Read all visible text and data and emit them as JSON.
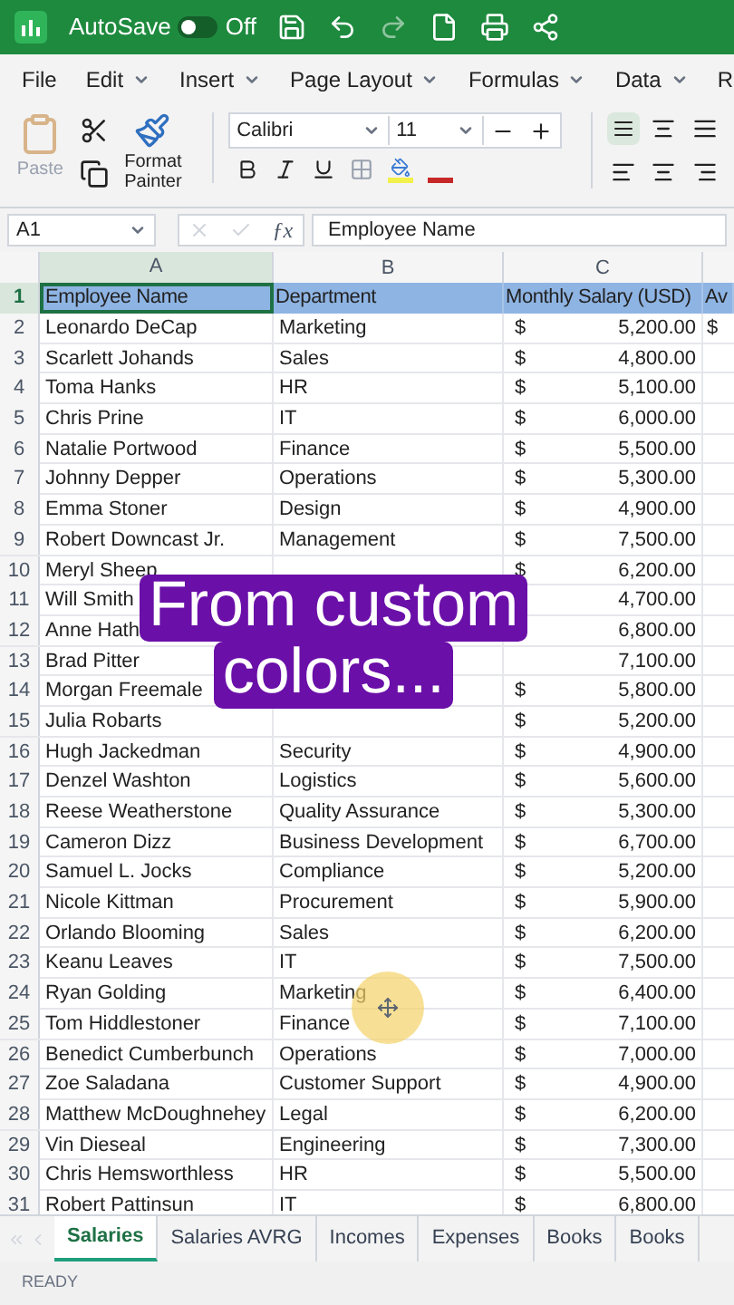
{
  "title_bar": {
    "autosave_label": "AutoSave",
    "autosave": {
      "on": false,
      "label": "Off"
    }
  },
  "menu": [
    {
      "label": "File",
      "caret": false
    },
    {
      "label": "Edit",
      "caret": true
    },
    {
      "label": "Insert",
      "caret": true
    },
    {
      "label": "Page Layout",
      "caret": true
    },
    {
      "label": "Formulas",
      "caret": true
    },
    {
      "label": "Data",
      "caret": true
    },
    {
      "label": "R",
      "caret": false
    }
  ],
  "ribbon": {
    "paste": {
      "label": "Paste",
      "disabled": true
    },
    "format_painter": "Format Painter",
    "font": "Calibri",
    "size": "11",
    "align_top_selected": true
  },
  "formula_bar": {
    "name_box": "A1",
    "function_label": "ƒx",
    "formula": "Employee Name"
  },
  "columns": [
    "A",
    "B",
    "C"
  ],
  "header_row": {
    "number": "1",
    "cells": [
      {
        "text": "Employee Name",
        "selected": true
      },
      {
        "text": "Department",
        "selected": false
      },
      {
        "text": "Monthly Salary (USD)",
        "selected": false
      },
      {
        "text": "Av",
        "selected": false
      }
    ]
  },
  "rows": [
    {
      "number": "2",
      "name": "Leonardo DeCap",
      "department": "Marketing",
      "currency": "$",
      "salary": "5,200.00",
      "column_d": "$"
    },
    {
      "number": "3",
      "name": "Scarlett Johands",
      "department": "Sales",
      "currency": "$",
      "salary": "4,800.00"
    },
    {
      "number": "4",
      "name": "Toma Hanks",
      "department": "HR",
      "currency": "$",
      "salary": "5,100.00"
    },
    {
      "number": "5",
      "name": "Chris Prine",
      "department": "IT",
      "currency": "$",
      "salary": "6,000.00"
    },
    {
      "number": "6",
      "name": "Natalie Portwood",
      "department": "Finance",
      "currency": "$",
      "salary": "5,500.00"
    },
    {
      "number": "7",
      "name": "Johnny Depper",
      "department": "Operations",
      "currency": "$",
      "salary": "5,300.00"
    },
    {
      "number": "8",
      "name": "Emma Stoner",
      "department": "Design",
      "currency": "$",
      "salary": "4,900.00"
    },
    {
      "number": "9",
      "name": "Robert Downcast Jr.",
      "department": "Management",
      "currency": "$",
      "salary": "7,500.00"
    },
    {
      "number": "10",
      "name": "Meryl Sheep",
      "currency": "$",
      "salary": "6,200.00"
    },
    {
      "number": "11",
      "name": "Will Smith",
      "salary": "4,700.00"
    },
    {
      "number": "12",
      "name": "Anne Hath",
      "salary": "6,800.00"
    },
    {
      "number": "13",
      "name": "Brad Pitter",
      "salary": "7,100.00"
    },
    {
      "number": "14",
      "name": "Morgan Freemale",
      "currency": "$",
      "salary": "5,800.00"
    },
    {
      "number": "15",
      "name": "Julia Robarts",
      "currency": "$",
      "salary": "5,200.00"
    },
    {
      "number": "16",
      "name": "Hugh Jackedman",
      "department": "Security",
      "currency": "$",
      "salary": "4,900.00"
    },
    {
      "number": "17",
      "name": "Denzel Washton",
      "department": "Logistics",
      "currency": "$",
      "salary": "5,600.00"
    },
    {
      "number": "18",
      "name": "Reese Weatherstone",
      "department": "Quality Assurance",
      "currency": "$",
      "salary": "5,300.00"
    },
    {
      "number": "19",
      "name": "Cameron Dizz",
      "department": "Business Development",
      "currency": "$",
      "salary": "6,700.00"
    },
    {
      "number": "20",
      "name": "Samuel L. Jocks",
      "department": "Compliance",
      "currency": "$",
      "salary": "5,200.00"
    },
    {
      "number": "21",
      "name": "Nicole Kittman",
      "department": "Procurement",
      "currency": "$",
      "salary": "5,900.00"
    },
    {
      "number": "22",
      "name": "Orlando Blooming",
      "department": "Sales",
      "currency": "$",
      "salary": "6,200.00"
    },
    {
      "number": "23",
      "name": "Keanu Leaves",
      "department": "IT",
      "currency": "$",
      "salary": "7,500.00"
    },
    {
      "number": "24",
      "name": "Ryan Golding",
      "department": "Marketing",
      "currency": "$",
      "salary": "6,400.00"
    },
    {
      "number": "25",
      "name": "Tom Hiddlestoner",
      "department": "Finance",
      "currency": "$",
      "salary": "7,100.00"
    },
    {
      "number": "26",
      "name": "Benedict Cumberbunch",
      "department": "Operations",
      "currency": "$",
      "salary": "7,000.00"
    },
    {
      "number": "27",
      "name": "Zoe Saladana",
      "department": "Customer Support",
      "currency": "$",
      "salary": "4,900.00"
    },
    {
      "number": "28",
      "name": "Matthew McDoughnehey",
      "department": "Legal",
      "currency": "$",
      "salary": "6,200.00"
    },
    {
      "number": "29",
      "name": "Vin Dieseal",
      "department": "Engineering",
      "currency": "$",
      "salary": "7,300.00"
    },
    {
      "number": "30",
      "name": "Chris Hemsworthless",
      "department": "HR",
      "currency": "$",
      "salary": "5,500.00"
    },
    {
      "number": "31",
      "name": "Robert Pattinsun",
      "department": "IT",
      "currency": "$",
      "salary": "6,800.00"
    }
  ],
  "caption": [
    "From custom",
    "colors..."
  ],
  "sheet_tabs": [
    {
      "label": "Salaries",
      "selected": true
    },
    {
      "label": "Salaries AVRG",
      "selected": false
    },
    {
      "label": "Incomes",
      "selected": false
    },
    {
      "label": "Expenses",
      "selected": false
    },
    {
      "label": "Books",
      "selected": false
    },
    {
      "label": "Books",
      "selected": false
    }
  ],
  "status_bar": "READY"
}
